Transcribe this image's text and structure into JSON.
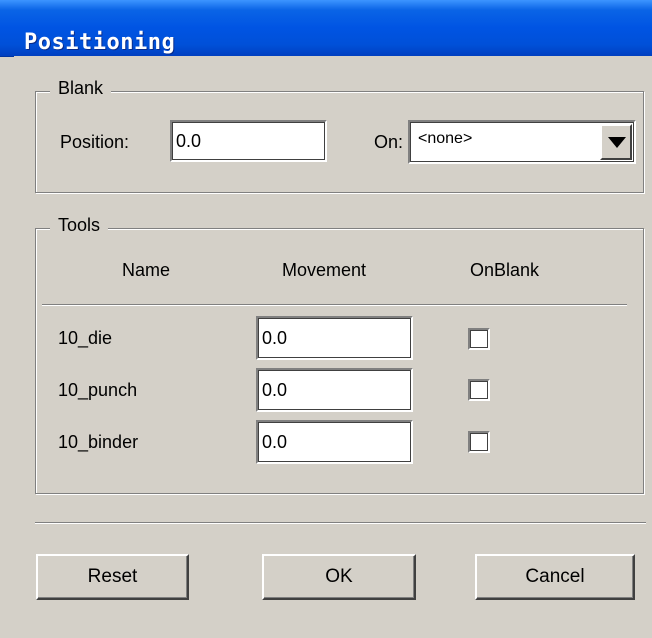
{
  "window": {
    "title": "Positioning"
  },
  "blank": {
    "legend": "Blank",
    "position_label": "Position:",
    "position_value": "0.0",
    "on_label": "On:",
    "on_value": "<none>"
  },
  "tools": {
    "legend": "Tools",
    "headers": {
      "name": "Name",
      "movement": "Movement",
      "onblank": "OnBlank"
    },
    "rows": [
      {
        "name": "10_die",
        "movement": "0.0",
        "onblank": false
      },
      {
        "name": "10_punch",
        "movement": "0.0",
        "onblank": false
      },
      {
        "name": "10_binder",
        "movement": "0.0",
        "onblank": false
      }
    ]
  },
  "buttons": {
    "reset": "Reset",
    "ok": "OK",
    "cancel": "Cancel"
  },
  "colors": {
    "titlebar": "#0054e3",
    "face": "#d4d0c8"
  }
}
